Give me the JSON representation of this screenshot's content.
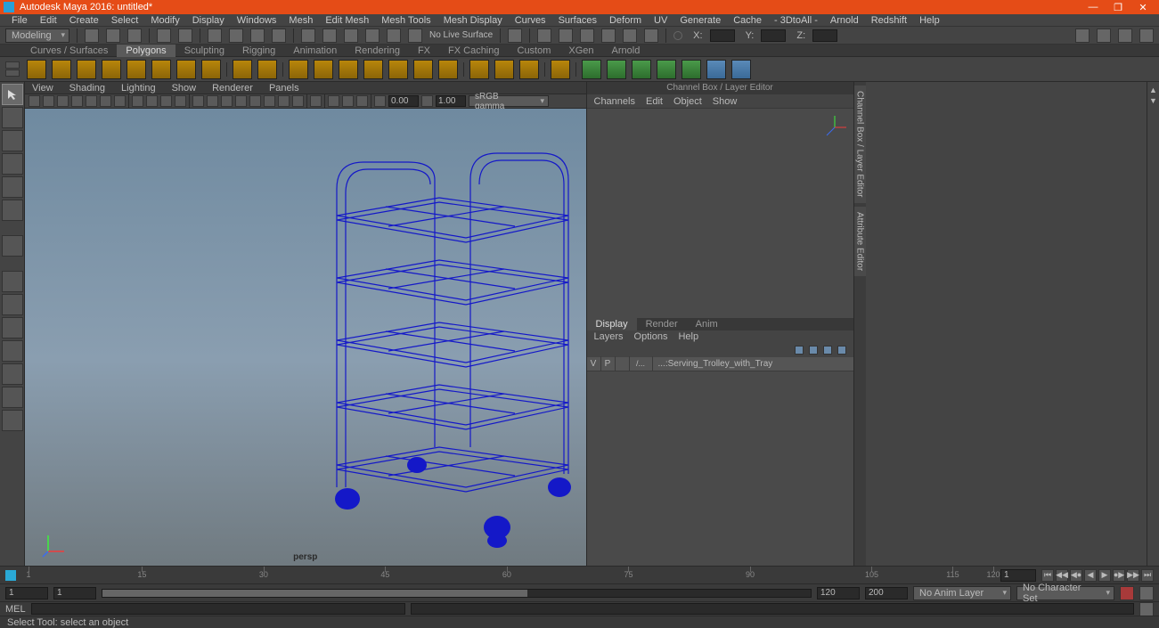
{
  "titlebar": {
    "title": "Autodesk Maya 2016: untitled*"
  },
  "menubar": [
    "File",
    "Edit",
    "Create",
    "Select",
    "Modify",
    "Display",
    "Windows",
    "Mesh",
    "Edit Mesh",
    "Mesh Tools",
    "Mesh Display",
    "Curves",
    "Surfaces",
    "Deform",
    "UV",
    "Generate",
    "Cache",
    "- 3DtoAll -",
    "Arnold",
    "Redshift",
    "Help"
  ],
  "workspace_mode": "Modeling",
  "coord_labels": {
    "x": "X:",
    "y": "Y:",
    "z": "Z:"
  },
  "no_live_surface": "No Live Surface",
  "shelf_tabs": [
    "Curves / Surfaces",
    "Polygons",
    "Sculpting",
    "Rigging",
    "Animation",
    "Rendering",
    "FX",
    "FX Caching",
    "Custom",
    "XGen",
    "Arnold"
  ],
  "active_shelf": "Polygons",
  "panel_menus": [
    "View",
    "Shading",
    "Lighting",
    "Show",
    "Renderer",
    "Panels"
  ],
  "panel_tb": {
    "exposure": "0.00",
    "gamma": "1.00",
    "colorspace": "sRGB gamma"
  },
  "viewport": {
    "camera": "persp"
  },
  "channelbox": {
    "title": "Channel Box / Layer Editor",
    "tabs": [
      "Channels",
      "Edit",
      "Object",
      "Show"
    ]
  },
  "layer_editor": {
    "tabs": [
      "Display",
      "Render",
      "Anim"
    ],
    "active": "Display",
    "menus": [
      "Layers",
      "Options",
      "Help"
    ],
    "headers": {
      "v": "V",
      "p": "P"
    },
    "items": [
      {
        "name": "...:Serving_Trolley_with_Tray",
        "v": "",
        "p": "",
        "rtype": "/..."
      }
    ]
  },
  "side_vtabs": [
    "Channel Box / Layer Editor",
    "Attribute Editor"
  ],
  "timeline": {
    "ticks": [
      1,
      15,
      30,
      45,
      60,
      75,
      90,
      105,
      115,
      120
    ],
    "start_outer": "1",
    "start_inner": "1",
    "end_inner": "120",
    "end_outer": "200",
    "anim_layer": "No Anim Layer",
    "char_set": "No Character Set",
    "current": "1"
  },
  "cmd": {
    "lang": "MEL"
  },
  "helpline": "Select Tool: select an object",
  "colors": {
    "accent": "#e54c17",
    "wire": "#1418c8"
  }
}
